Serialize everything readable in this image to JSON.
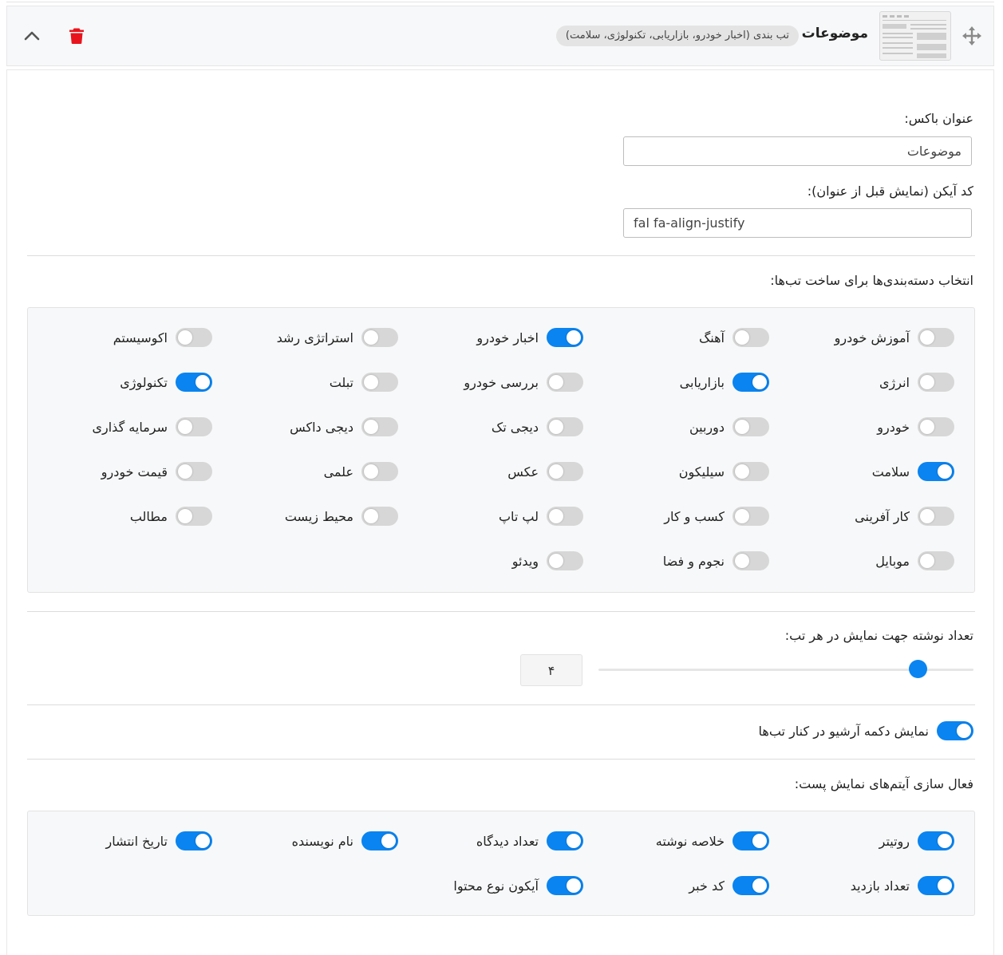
{
  "header": {
    "title": "موضوعات",
    "summary": "تب بندی (اخبار خودرو، بازاریابی، تکنولوژی، سلامت)",
    "move_icon": "move-arrows-icon",
    "delete_icon": "trash-icon",
    "collapse_icon": "chevron-up-icon",
    "delete_color": "#e8141d",
    "accent_color": "#0a84f0"
  },
  "form": {
    "box_title_label": "عنوان باکس:",
    "box_title_value": "موضوعات",
    "icon_code_label": "کد آیکن (نمایش قبل از عنوان):",
    "icon_code_value": "fal fa-align-justify",
    "categories_label": "انتخاب دسته‌بندی‌ها برای ساخت تب‌ها:",
    "categories": [
      {
        "label": "آموزش خودرو",
        "on": false
      },
      {
        "label": "آهنگ",
        "on": false
      },
      {
        "label": "اخبار خودرو",
        "on": true
      },
      {
        "label": "استراتژی رشد",
        "on": false
      },
      {
        "label": "اکوسیستم",
        "on": false
      },
      {
        "label": "انرژی",
        "on": false
      },
      {
        "label": "بازاریابی",
        "on": true
      },
      {
        "label": "بررسی خودرو",
        "on": false
      },
      {
        "label": "تبلت",
        "on": false
      },
      {
        "label": "تکنولوژی",
        "on": true
      },
      {
        "label": "خودرو",
        "on": false
      },
      {
        "label": "دوربین",
        "on": false
      },
      {
        "label": "دیجی تک",
        "on": false
      },
      {
        "label": "دیجی داکس",
        "on": false
      },
      {
        "label": "سرمایه گذاری",
        "on": false
      },
      {
        "label": "سلامت",
        "on": true
      },
      {
        "label": "سیلیکون",
        "on": false
      },
      {
        "label": "عکس",
        "on": false
      },
      {
        "label": "علمی",
        "on": false
      },
      {
        "label": "قیمت خودرو",
        "on": false
      },
      {
        "label": "کار آفرینی",
        "on": false
      },
      {
        "label": "کسب و کار",
        "on": false
      },
      {
        "label": "لپ تاپ",
        "on": false
      },
      {
        "label": "محیط زیست",
        "on": false
      },
      {
        "label": "مطالب",
        "on": false
      },
      {
        "label": "موبایل",
        "on": false
      },
      {
        "label": "نجوم و فضا",
        "on": false
      },
      {
        "label": "ویدئو",
        "on": false
      }
    ],
    "post_count_label": "تعداد نوشته جهت نمایش در هر تب:",
    "post_count_value": "۴",
    "post_count_fraction": 0.87,
    "archive_toggle_label": "نمایش دکمه آرشیو در کنار تب‌ها",
    "archive_toggle_on": true,
    "post_items_label": "فعال سازی آیتم‌های نمایش پست:",
    "post_items": [
      {
        "label": "روتیتر",
        "on": true
      },
      {
        "label": "خلاصه نوشته",
        "on": true
      },
      {
        "label": "تعداد دیدگاه",
        "on": true
      },
      {
        "label": "نام نویسنده",
        "on": true
      },
      {
        "label": "تاریخ انتشار",
        "on": true
      },
      {
        "label": "تعداد بازدید",
        "on": true
      },
      {
        "label": "کد خبر",
        "on": true
      },
      {
        "label": "آیکون نوع محتوا",
        "on": true
      }
    ]
  }
}
